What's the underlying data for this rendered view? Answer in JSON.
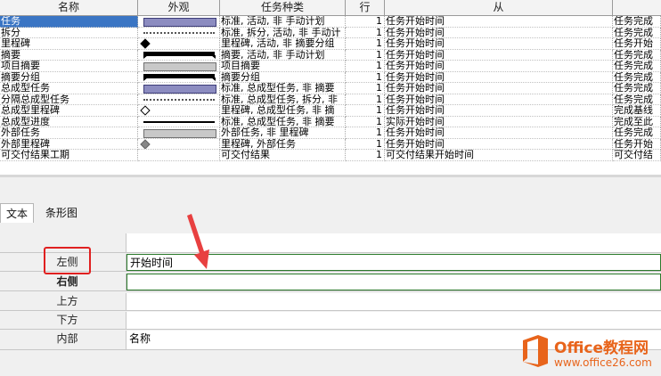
{
  "grid": {
    "headers": {
      "name": "名称",
      "appearance": "外观",
      "task_types": "任务种类",
      "row": "行",
      "from": "从",
      "to": ""
    },
    "rows": [
      {
        "name": "任务",
        "app": "blue",
        "kind": "标准, 活动, 非 手动计划",
        "row": "1",
        "from": "任务开始时间",
        "to": "任务完成",
        "selected": true
      },
      {
        "name": "拆分",
        "app": "dots",
        "kind": "标准, 拆分, 活动, 非 手动计",
        "row": "1",
        "from": "任务开始时间",
        "to": "任务完成"
      },
      {
        "name": "里程碑",
        "app": "diamond-black",
        "kind": "里程碑, 活动, 非 摘要分组",
        "row": "1",
        "from": "任务开始时间",
        "to": "任务开始"
      },
      {
        "name": "摘要",
        "app": "summary",
        "kind": "摘要, 活动, 非 手动计划",
        "row": "1",
        "from": "任务开始时间",
        "to": "任务完成"
      },
      {
        "name": "项目摘要",
        "app": "gray",
        "kind": "项目摘要",
        "row": "1",
        "from": "任务开始时间",
        "to": "任务完成"
      },
      {
        "name": "摘要分组",
        "app": "summary",
        "kind": "摘要分组",
        "row": "1",
        "from": "任务开始时间",
        "to": "任务完成"
      },
      {
        "name": "总成型任务",
        "app": "blue",
        "kind": "标准, 总成型任务, 非 摘要",
        "row": "1",
        "from": "任务开始时间",
        "to": "任务完成"
      },
      {
        "name": "分隔总成型任务",
        "app": "dots",
        "kind": "标准, 总成型任务, 拆分, 非",
        "row": "1",
        "from": "任务开始时间",
        "to": "任务完成"
      },
      {
        "name": "总成型里程碑",
        "app": "diamond-white",
        "kind": "里程碑, 总成型任务, 非 摘",
        "row": "1",
        "from": "任务开始时间",
        "to": "完成基线"
      },
      {
        "name": "总成型进度",
        "app": "thin",
        "kind": "标准, 总成型任务, 非 摘要",
        "row": "1",
        "from": "实际开始时间",
        "to": "完成至此"
      },
      {
        "name": "外部任务",
        "app": "gray",
        "kind": "外部任务, 非 里程碑",
        "row": "1",
        "from": "任务开始时间",
        "to": "任务完成"
      },
      {
        "name": "外部里程碑",
        "app": "diamond-gray",
        "kind": "里程碑, 外部任务",
        "row": "1",
        "from": "任务开始时间",
        "to": "任务开始"
      },
      {
        "name": "可交付结果工期",
        "app": "",
        "kind": "可交付结果",
        "row": "1",
        "from": "可交付结果开始时间",
        "to": "可交付结"
      }
    ]
  },
  "tabs": [
    "文本",
    "条形图"
  ],
  "props": {
    "rows": [
      {
        "label": "左侧",
        "value": "开始时间",
        "bold": false
      },
      {
        "label": "右侧",
        "value": "",
        "bold": true
      },
      {
        "label": "上方",
        "value": "",
        "bold": false
      },
      {
        "label": "下方",
        "value": "",
        "bold": false
      },
      {
        "label": "内部",
        "value": "名称",
        "bold": false
      }
    ]
  },
  "logo": {
    "brand": "Office教程网",
    "url": "www.office26.com"
  },
  "colors": {
    "selection": "#3a75c4",
    "highlight_box": "#e02020",
    "arrow": "#e84040",
    "logo": "#e8641b"
  }
}
